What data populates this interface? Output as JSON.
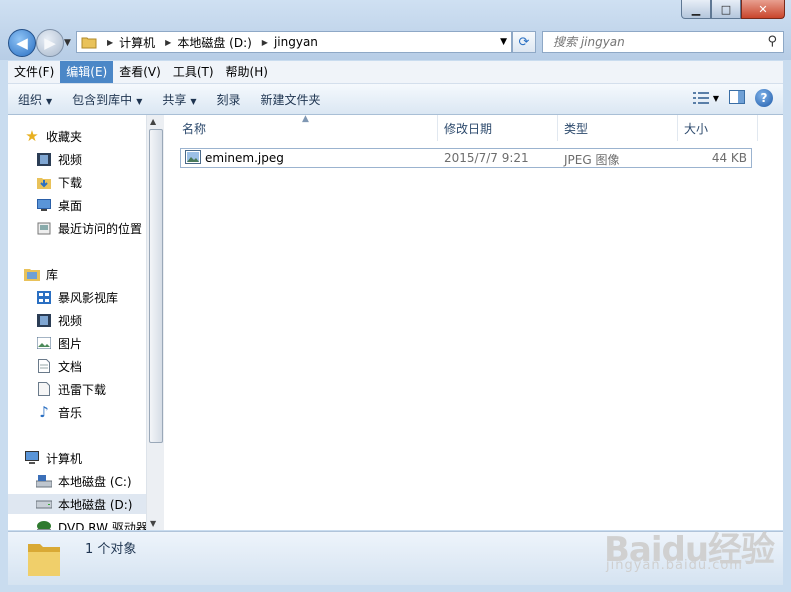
{
  "window": {
    "caption": {
      "minimize": "▁",
      "maximize": "□",
      "close": "✕"
    }
  },
  "address": {
    "segments": [
      "计算机",
      "本地磁盘 (D:)",
      "jingyan"
    ]
  },
  "search": {
    "placeholder": "搜索 jingyan"
  },
  "menu": [
    "文件(F)",
    "编辑(E)",
    "查看(V)",
    "工具(T)",
    "帮助(H)"
  ],
  "menu_active_index": 1,
  "toolbar": {
    "organize": "组织",
    "include_library": "包含到库中",
    "share": "共享",
    "burn": "刻录",
    "new_folder": "新建文件夹"
  },
  "nav": {
    "favorites": {
      "title": "收藏夹",
      "items": [
        "视频",
        "下载",
        "桌面",
        "最近访问的位置"
      ]
    },
    "library": {
      "title": "库",
      "items": [
        "暴风影视库",
        "视频",
        "图片",
        "文档",
        "迅雷下载",
        "音乐"
      ]
    },
    "computer": {
      "title": "计算机",
      "items": [
        "本地磁盘 (C:)",
        "本地磁盘 (D:)",
        "DVD RW 驱动器"
      ]
    },
    "selected": "本地磁盘 (D:)"
  },
  "columns": {
    "name": "名称",
    "date": "修改日期",
    "type": "类型",
    "size": "大小"
  },
  "files": [
    {
      "name": "eminem.jpeg",
      "date": "2015/7/7 9:21",
      "type": "JPEG 图像",
      "size": "44 KB"
    }
  ],
  "status": {
    "text": "1 个对象"
  },
  "watermark": {
    "logo": "Baidu经验",
    "url": "jingyan.baidu.com"
  },
  "colors": {
    "accent": "#4b87c7",
    "chrome": "#c9dcef",
    "selection": "#dfe7f1"
  }
}
